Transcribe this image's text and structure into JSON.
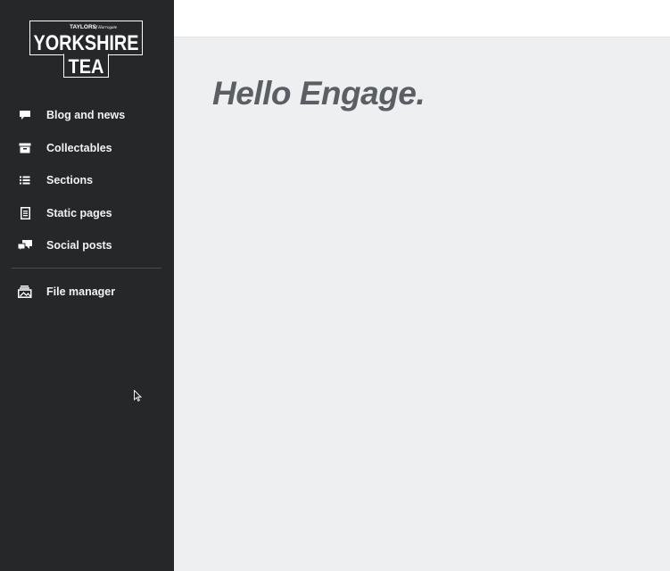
{
  "brand": {
    "logo_line_small": "TAYLORS",
    "logo_line_script": "of Harrogate",
    "logo_line_main": "YORKSHIRE",
    "logo_line_sub": "TEA"
  },
  "sidebar": {
    "items": [
      {
        "label": "Blog and news",
        "icon": "speech-bubble-icon"
      },
      {
        "label": "Collectables",
        "icon": "archive-box-icon"
      },
      {
        "label": "Sections",
        "icon": "list-icon"
      },
      {
        "label": "Static pages",
        "icon": "document-icon"
      },
      {
        "label": "Social posts",
        "icon": "chat-bubbles-icon"
      }
    ],
    "secondary_items": [
      {
        "label": "File manager",
        "icon": "file-manager-icon"
      }
    ]
  },
  "main": {
    "greeting": "Hello Engage."
  },
  "colors": {
    "sidebar_bg": "#262729",
    "content_bg": "#eeeff1",
    "topbar_bg": "#ffffff",
    "title_text": "#5b5e63"
  }
}
